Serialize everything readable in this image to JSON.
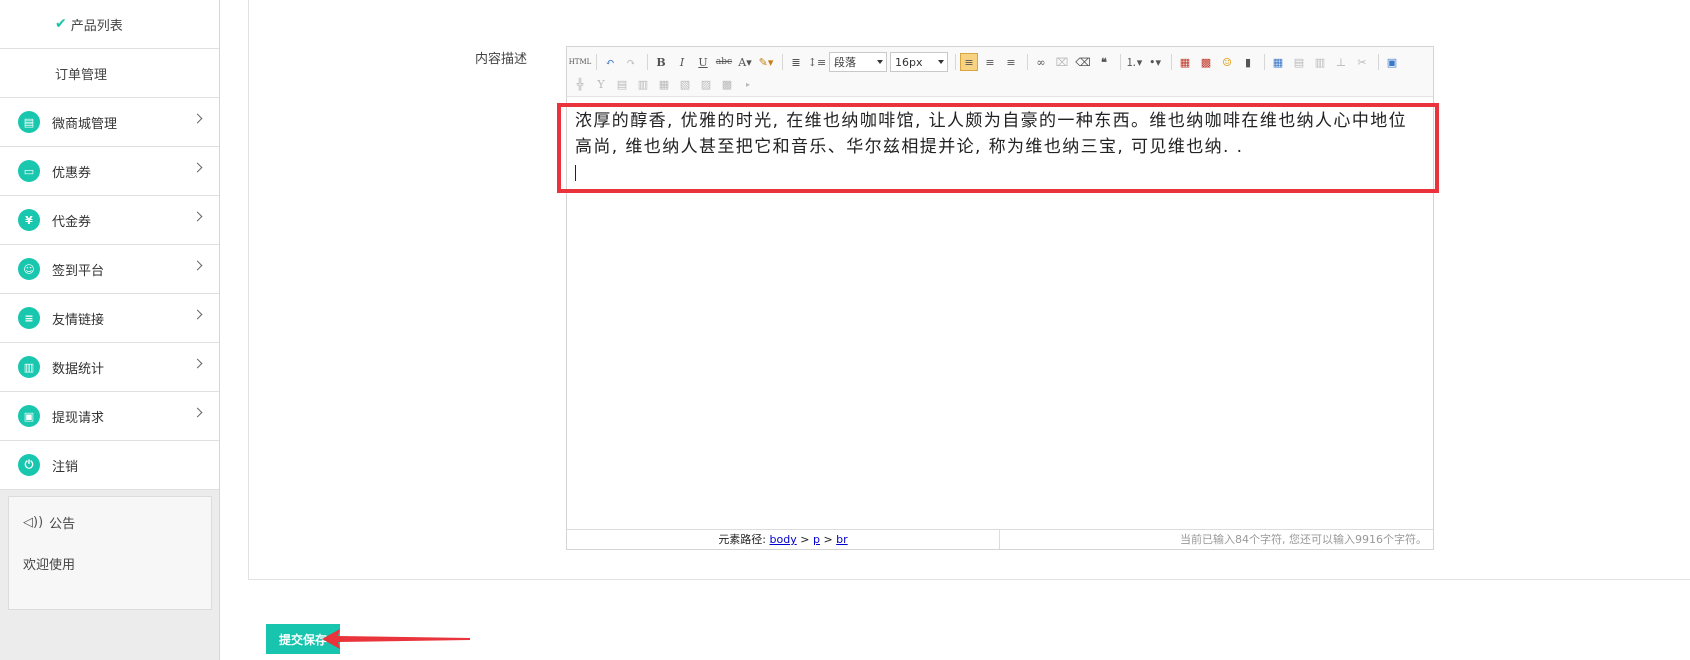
{
  "sidebar": {
    "sub_items": [
      {
        "label": "产品列表",
        "active": true
      },
      {
        "label": "订单管理",
        "active": false
      }
    ],
    "nav_items": [
      {
        "label": "微商城管理",
        "icon": "shop-icon",
        "glyph": "▤"
      },
      {
        "label": "优惠券",
        "icon": "coupon-icon",
        "glyph": "▭"
      },
      {
        "label": "代金券",
        "icon": "voucher-icon",
        "glyph": "¥"
      },
      {
        "label": "签到平台",
        "icon": "checkin-icon",
        "glyph": "☺"
      },
      {
        "label": "友情链接",
        "icon": "link-icon",
        "glyph": "≡"
      },
      {
        "label": "数据统计",
        "icon": "stats-icon",
        "glyph": "▥"
      },
      {
        "label": "提现请求",
        "icon": "withdraw-icon",
        "glyph": "▣"
      },
      {
        "label": "注销",
        "icon": "power-icon",
        "glyph": "⏻"
      }
    ],
    "notice": {
      "title": "公告",
      "body": "欢迎使用"
    }
  },
  "form": {
    "field_label": "内容描述"
  },
  "editor": {
    "paragraph_select": "段落",
    "size_select": "16px",
    "content": "浓厚的醇香, 优雅的时光, 在维也纳咖啡馆, 让人颇为自豪的一种东西。维也纳咖啡在维也纳人心中地位高尚, 维也纳人甚至把它和音乐、华尔兹相提并论, 称为维也纳三宝, 可见维也纳. .",
    "status_path_label": "元素路径:",
    "status_path": [
      "body",
      "p",
      "br"
    ],
    "status_sep": ">",
    "char_count": "当前已输入84个字符, 您还可以输入9916个字符。"
  },
  "actions": {
    "save_label": "提交保存"
  },
  "colors": {
    "accent": "#17c4ae",
    "highlight": "#e8343a"
  }
}
